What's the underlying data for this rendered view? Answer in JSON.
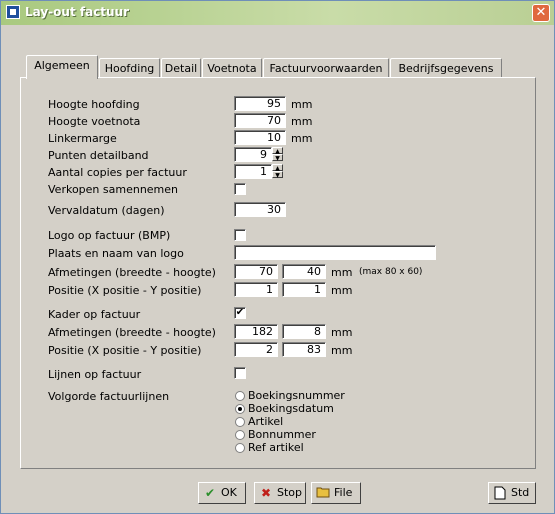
{
  "window": {
    "title": "Lay-out factuur",
    "close_label": "✕"
  },
  "tabs": [
    "Algemeen",
    "Hoofding",
    "Detail",
    "Voetnota",
    "Factuurvoorwaarden",
    "Bedrijfsgegevens"
  ],
  "form": {
    "hoogte_hoofding": {
      "label": "Hoogte hoofding",
      "value": "95",
      "unit": "mm"
    },
    "hoogte_voetnota": {
      "label": "Hoogte voetnota",
      "value": "70",
      "unit": "mm"
    },
    "linkermarge": {
      "label": "Linkermarge",
      "value": "10",
      "unit": "mm"
    },
    "punten_detailband": {
      "label": "Punten detailband",
      "value": "9"
    },
    "aantal_copies": {
      "label": "Aantal copies per factuur",
      "value": "1"
    },
    "verkopen_samennemen": {
      "label": "Verkopen samennemen",
      "checked": false
    },
    "vervaldatum": {
      "label": "Vervaldatum (dagen)",
      "value": "30"
    },
    "logo_op_factuur": {
      "label": "Logo op factuur (BMP)",
      "checked": false
    },
    "plaats_logo": {
      "label": "Plaats en naam van logo",
      "value": ""
    },
    "afmetingen_logo": {
      "label": "Afmetingen (breedte - hoogte)",
      "breedte": "70",
      "hoogte": "40",
      "unit": "mm",
      "note": "(max 80 x 60)"
    },
    "positie_logo": {
      "label": "Positie (X positie - Y positie)",
      "x": "1",
      "y": "1",
      "unit": "mm"
    },
    "kader_op_factuur": {
      "label": "Kader op factuur",
      "checked": true
    },
    "afmetingen_kader": {
      "label": "Afmetingen (breedte - hoogte)",
      "breedte": "182",
      "hoogte": "8",
      "unit": "mm"
    },
    "positie_kader": {
      "label": "Positie (X positie - Y positie)",
      "x": "2",
      "y": "83",
      "unit": "mm"
    },
    "lijnen_op_factuur": {
      "label": "Lijnen op factuur",
      "checked": false
    },
    "volgorde": {
      "label": "Volgorde factuurlijnen",
      "options": [
        "Boekingsnummer",
        "Boekingsdatum",
        "Artikel",
        "Bonnummer",
        "Ref artikel"
      ],
      "selected": "Boekingsdatum"
    }
  },
  "buttons": {
    "ok": "OK",
    "stop": "Stop",
    "file": "File",
    "std": "Std"
  },
  "icons": {
    "ok": "ok-check-icon",
    "stop": "stop-x-icon",
    "file": "folder-icon",
    "std": "page-icon"
  },
  "colors": {
    "titlebar": "#b9cf94",
    "close": "#e0683e",
    "stop_icon": "#c0201a",
    "ok_icon": "#2c8f2c",
    "folder_icon": "#e8c040"
  }
}
